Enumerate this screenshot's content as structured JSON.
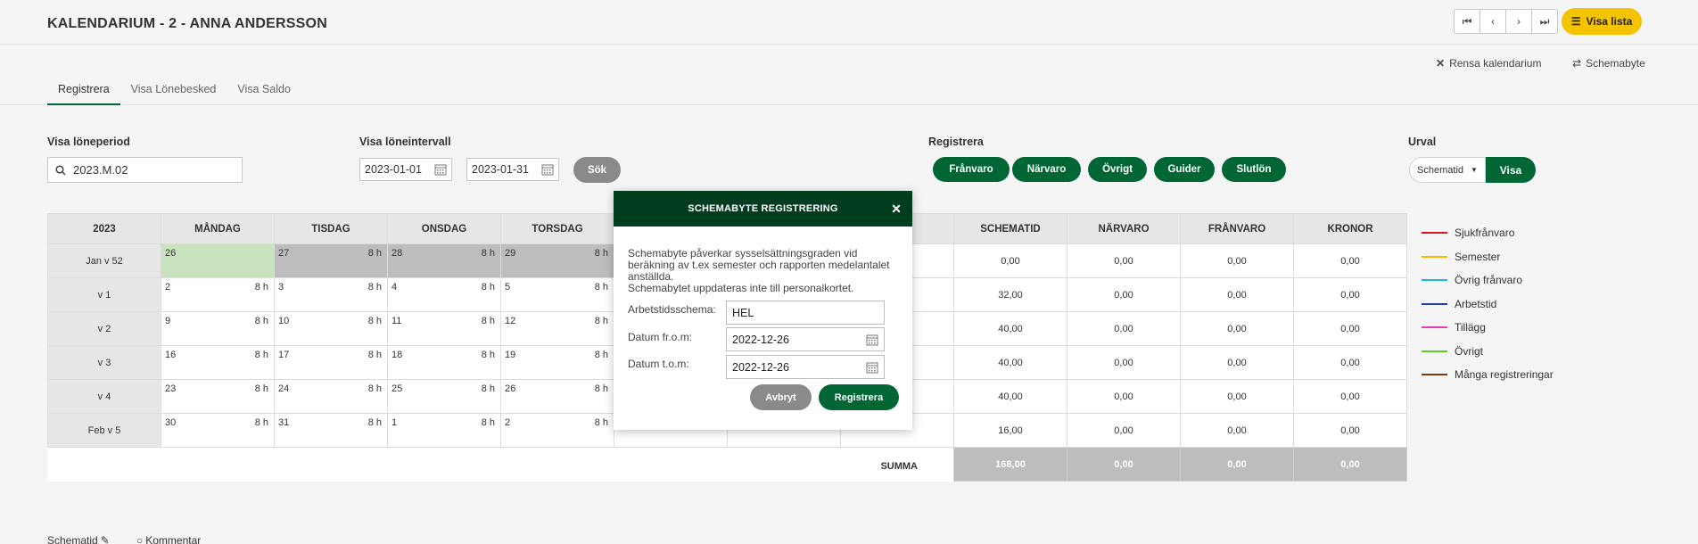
{
  "header": {
    "title": "KALENDARIUM - 2 - ANNA ANDERSSON",
    "visa_lista": "Visa lista"
  },
  "actions": {
    "rensa": "Rensa kalendarium",
    "schemabyte": "Schemabyte"
  },
  "tabs": [
    {
      "label": "Registrera",
      "active": true
    },
    {
      "label": "Visa Lönebesked",
      "active": false
    },
    {
      "label": "Visa Saldo",
      "active": false
    }
  ],
  "filters": {
    "period_label": "Visa löneperiod",
    "period_value": "2023.M.02",
    "interval_label": "Visa löneintervall",
    "date_from": "2023-01-01",
    "date_to": "2023-01-31",
    "search_button": "Sök",
    "registrera_label": "Registrera",
    "registrera_buttons": [
      "Frånvaro",
      "Närvaro",
      "Övrigt",
      "Guider",
      "Slutlön"
    ],
    "urval_label": "Urval",
    "urval_value": "Schematid",
    "urval_button": "Visa"
  },
  "calendar": {
    "headers": [
      "2023",
      "MÅNDAG",
      "TISDAG",
      "ONSDAG",
      "TORSDAG",
      "",
      "",
      "",
      "SCHEMATID",
      "NÄRVARO",
      "FRÅNVARO",
      "KRONOR"
    ],
    "rows": [
      {
        "week": "Jan v 52",
        "days": [
          [
            "26",
            ""
          ],
          [
            "27",
            "8 h"
          ],
          [
            "28",
            "8 h"
          ],
          [
            "29",
            "8 h"
          ]
        ],
        "totals": [
          "0,00",
          "0,00",
          "0,00",
          "0,00"
        ]
      },
      {
        "week": "v 1",
        "days": [
          [
            "2",
            "8 h"
          ],
          [
            "3",
            "8 h"
          ],
          [
            "4",
            "8 h"
          ],
          [
            "5",
            "8 h"
          ]
        ],
        "totals": [
          "32,00",
          "0,00",
          "0,00",
          "0,00"
        ]
      },
      {
        "week": "v 2",
        "days": [
          [
            "9",
            "8 h"
          ],
          [
            "10",
            "8 h"
          ],
          [
            "11",
            "8 h"
          ],
          [
            "12",
            "8 h"
          ]
        ],
        "totals": [
          "40,00",
          "0,00",
          "0,00",
          "0,00"
        ]
      },
      {
        "week": "v 3",
        "days": [
          [
            "16",
            "8 h"
          ],
          [
            "17",
            "8 h"
          ],
          [
            "18",
            "8 h"
          ],
          [
            "19",
            "8 h"
          ]
        ],
        "totals": [
          "40,00",
          "0,00",
          "0,00",
          "0,00"
        ]
      },
      {
        "week": "v 4",
        "days": [
          [
            "23",
            "8 h"
          ],
          [
            "24",
            "8 h"
          ],
          [
            "25",
            "8 h"
          ],
          [
            "26",
            "8 h"
          ]
        ],
        "totals": [
          "40,00",
          "0,00",
          "0,00",
          "0,00"
        ]
      },
      {
        "week": "Feb v 5",
        "days": [
          [
            "30",
            "8 h"
          ],
          [
            "31",
            "8 h"
          ],
          [
            "1",
            "8 h"
          ],
          [
            "2",
            "8 h"
          ]
        ],
        "totals": [
          "16,00",
          "0,00",
          "0,00",
          "0,00"
        ]
      }
    ],
    "summa_label": "SUMMA",
    "summa_values": [
      "168,00",
      "0,00",
      "0,00",
      "0,00"
    ]
  },
  "legend": [
    {
      "label": "Sjukfrånvaro",
      "color": "#d9191f"
    },
    {
      "label": "Semester",
      "color": "#f5b800"
    },
    {
      "label": "Övrig frånvaro",
      "color": "#1fb6d6"
    },
    {
      "label": "Arbetstid",
      "color": "#1f3f9e"
    },
    {
      "label": "Tillägg",
      "color": "#e03fb5"
    },
    {
      "label": "Övrigt",
      "color": "#5ccf2c"
    },
    {
      "label": "Många registreringar",
      "color": "#7a3b12"
    }
  ],
  "bottom": {
    "schematid": "Schematid",
    "kommentar": "Kommentar"
  },
  "modal": {
    "title": "SCHEMABYTE REGISTRERING",
    "text1": "Schemabyte påverkar sysselsättningsgraden vid beräkning av t.ex semester och rapporten medelantalet anställda.",
    "text2": "Schemabytet uppdateras inte till personalkortet.",
    "schema_label": "Arbetstidsschema:",
    "schema_value": "HEL",
    "from_label": "Datum fr.o.m:",
    "from_value": "2022-12-26",
    "tom_label": "Datum t.o.m:",
    "tom_value": "2022-12-26",
    "cancel": "Avbryt",
    "submit": "Registrera"
  },
  "colors": {
    "primary_green": "#006633",
    "dark_green": "#003d1e",
    "yellow": "#f5c400"
  }
}
